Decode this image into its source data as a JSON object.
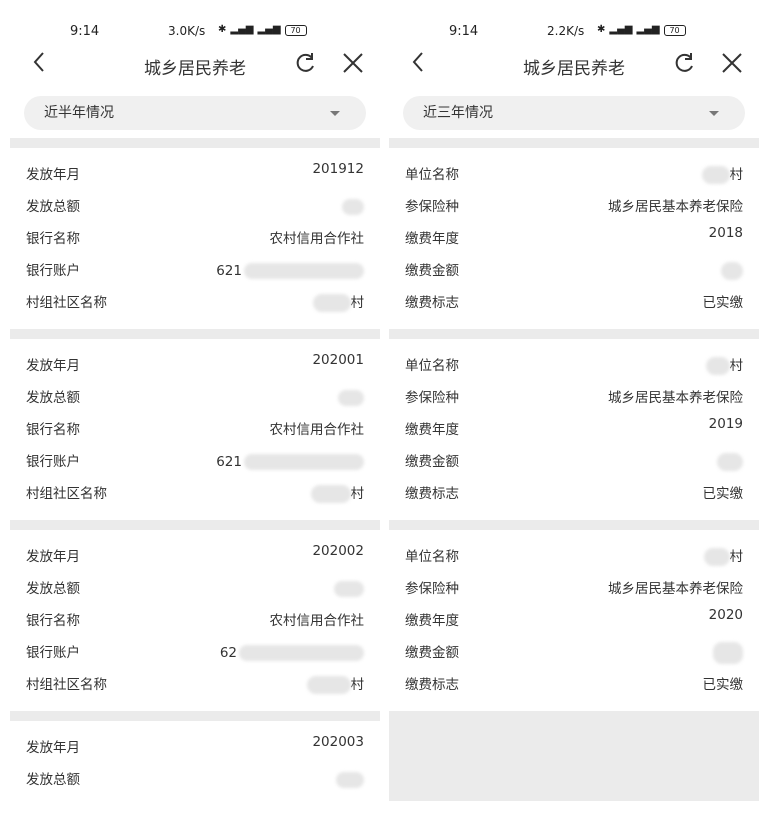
{
  "left": {
    "status": {
      "time": "9:14",
      "speed": "3.0K/s",
      "battery": "70"
    },
    "title": "城乡居民养老",
    "dropdown": "近半年情况",
    "labels": {
      "month": "发放年月",
      "total": "发放总额",
      "bank": "银行名称",
      "account": "银行账户",
      "village": "村组社区名称"
    },
    "records": [
      {
        "month": "201912",
        "bank": "农村信用合作社",
        "account_prefix": "621",
        "village_suffix": "村"
      },
      {
        "month": "202001",
        "bank": "农村信用合作社",
        "account_prefix": "621",
        "village_suffix": "村"
      },
      {
        "month": "202002",
        "bank": "农村信用合作社",
        "account_prefix": "62",
        "village_suffix": "村"
      },
      {
        "month": "202003"
      }
    ]
  },
  "right": {
    "status": {
      "time": "9:14",
      "speed": "2.2K/s",
      "battery": "70"
    },
    "title": "城乡居民养老",
    "dropdown": "近三年情况",
    "labels": {
      "unit": "单位名称",
      "insurance": "参保险种",
      "year": "缴费年度",
      "amount": "缴费金额",
      "flag": "缴费标志"
    },
    "records": [
      {
        "unit_suffix": "村",
        "insurance": "城乡居民基本养老保险",
        "year": "2018",
        "flag": "已实缴"
      },
      {
        "unit_suffix": "村",
        "insurance": "城乡居民基本养老保险",
        "year": "2019",
        "flag": "已实缴"
      },
      {
        "unit_suffix": "村",
        "insurance": "城乡居民基本养老保险",
        "year": "2020",
        "flag": "已实缴"
      }
    ]
  },
  "icons": [
    "back-icon",
    "refresh-icon",
    "close-icon",
    "dropdown-caret-icon",
    "bluetooth-icon",
    "signal-icon",
    "battery-icon"
  ]
}
